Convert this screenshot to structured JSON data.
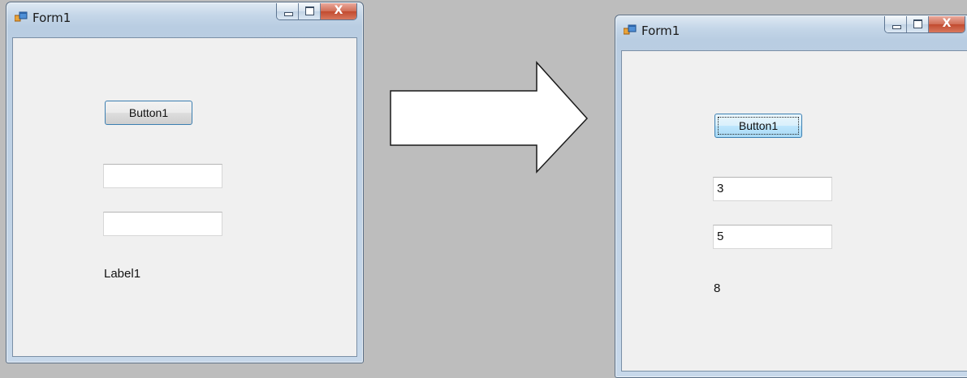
{
  "before": {
    "window_title": "Form1",
    "close_glyph": "X",
    "button_label": "Button1",
    "textbox1_value": "",
    "textbox2_value": "",
    "label_text": "Label1"
  },
  "after": {
    "window_title": "Form1",
    "close_glyph": "X",
    "button_label": "Button1",
    "textbox1_value": "3",
    "textbox2_value": "5",
    "label_text": "8"
  },
  "icons": {
    "app_icon": "winforms-app-icon",
    "arrow": "right-arrow-icon"
  },
  "colors": {
    "background": "#bdbdbd",
    "client_area": "#f0f0f0",
    "frame": "#c4d6e8",
    "close_button": "#c24a2f"
  }
}
